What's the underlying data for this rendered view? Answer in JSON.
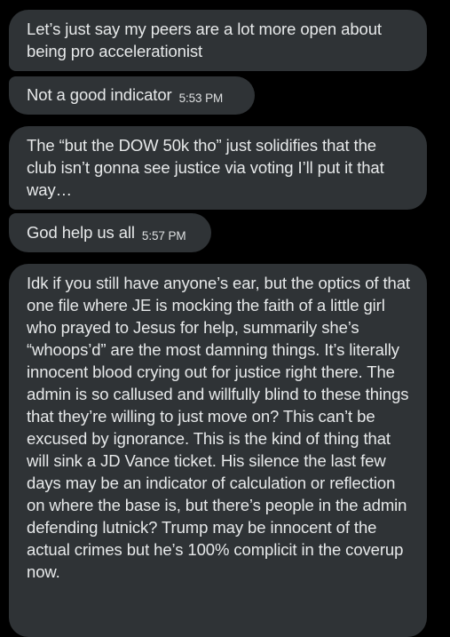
{
  "messages": [
    {
      "text": "Let’s just say my peers are a lot more open about being pro accelerationist",
      "time": ""
    },
    {
      "text": "Not a good indicator",
      "time": "5:53 PM"
    },
    {
      "text": "The “but the DOW 50k tho” just solidifies that the club isn’t gonna see justice via voting I’ll put it that way…",
      "time": ""
    },
    {
      "text": "God help us all",
      "time": "5:57 PM"
    },
    {
      "text": "Idk if you still have anyone’s ear, but the optics of that one file where JE is mocking the faith of a little girl who prayed to Jesus for help, summarily she’s “whoops’d” are the most damning things. It’s literally innocent blood crying out for justice right there. The admin is so callused and willfully blind to these things that they’re willing to just move on? This can’t be excused by ignorance. This is the kind of thing that will sink a JD Vance ticket. His silence the last few days may be an indicator of calculation or reflection on where the base is, but there’s people in the admin defending lutnick? Trump may be innocent of the actual crimes but he’s 100% complicit in the coverup now.",
      "time": ""
    }
  ],
  "colors": {
    "background": "#000000",
    "bubble": "#2f3336",
    "text": "#e7e9ea"
  }
}
